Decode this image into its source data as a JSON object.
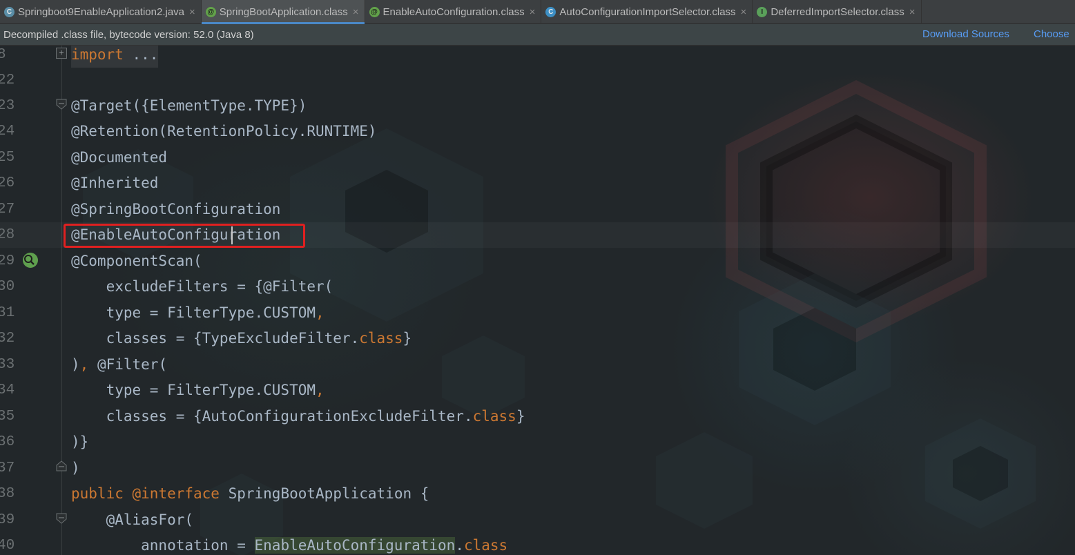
{
  "tabs": [
    {
      "label": "Springboot9EnableApplication2.java",
      "icon": "java-class-icon",
      "active": false
    },
    {
      "label": "SpringBootApplication.class",
      "icon": "annotation-icon",
      "active": true
    },
    {
      "label": "EnableAutoConfiguration.class",
      "icon": "annotation-icon",
      "active": false
    },
    {
      "label": "AutoConfigurationImportSelector.class",
      "icon": "class-icon",
      "active": false
    },
    {
      "label": "DeferredImportSelector.class",
      "icon": "interface-icon",
      "active": false
    }
  ],
  "banner": {
    "message": "Decompiled .class file, bytecode version: 52.0 (Java 8)",
    "download_sources": "Download Sources",
    "choose": "Choose"
  },
  "editor": {
    "lines": [
      {
        "num": "8",
        "code": "import ..."
      },
      {
        "num": "22",
        "code": ""
      },
      {
        "num": "23",
        "code": "@Target({ElementType.TYPE})"
      },
      {
        "num": "24",
        "code": "@Retention(RetentionPolicy.RUNTIME)"
      },
      {
        "num": "25",
        "code": "@Documented"
      },
      {
        "num": "26",
        "code": "@Inherited"
      },
      {
        "num": "27",
        "code": "@SpringBootConfiguration"
      },
      {
        "num": "28",
        "code": "@EnableAutoConfiguration"
      },
      {
        "num": "29",
        "code": "@ComponentScan("
      },
      {
        "num": "30",
        "code": "    excludeFilters = {@Filter("
      },
      {
        "num": "31",
        "code": "    type = FilterType.CUSTOM,"
      },
      {
        "num": "32",
        "code": "    classes = {TypeExcludeFilter.class}"
      },
      {
        "num": "33",
        "code": "), @Filter("
      },
      {
        "num": "34",
        "code": "    type = FilterType.CUSTOM,"
      },
      {
        "num": "35",
        "code": "    classes = {AutoConfigurationExcludeFilter.class}"
      },
      {
        "num": "36",
        "code": ")}"
      },
      {
        "num": "37",
        "code": ")"
      },
      {
        "num": "38",
        "code": "public @interface SpringBootApplication {"
      },
      {
        "num": "39",
        "code": "    @AliasFor("
      },
      {
        "num": "40",
        "code": "        annotation = EnableAutoConfiguration.class"
      }
    ]
  },
  "colors": {
    "annotation": "#bbb529",
    "keyword": "#cc7832",
    "text": "#a9b7c6",
    "highlight_box": "#e02020",
    "link": "#589df6"
  }
}
